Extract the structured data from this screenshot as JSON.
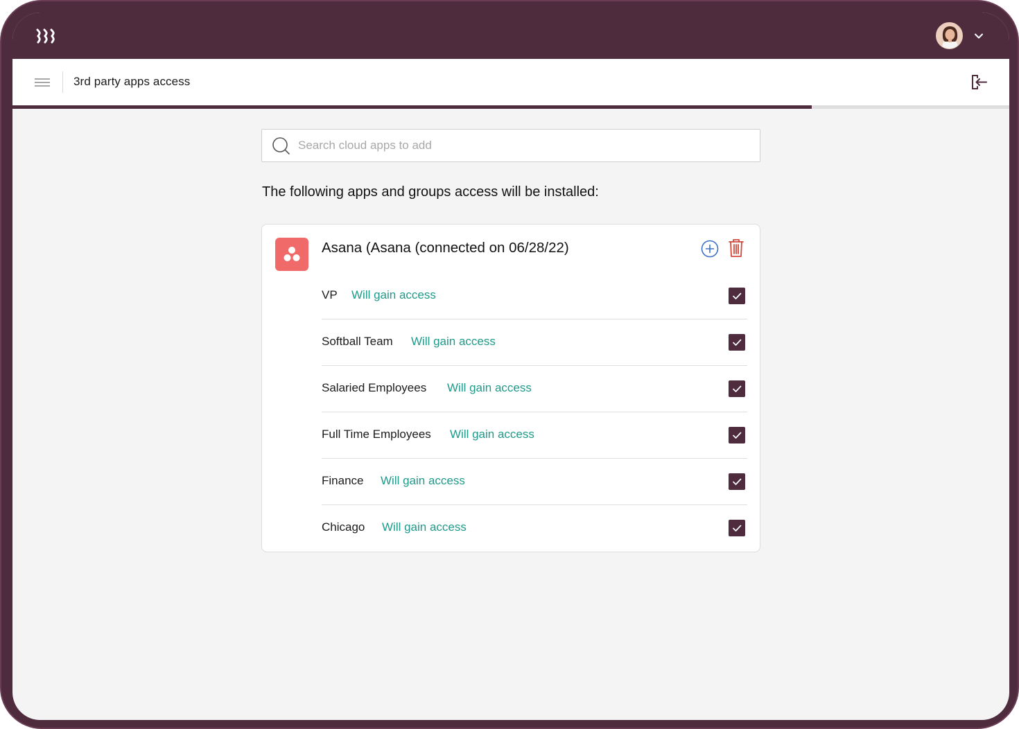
{
  "header": {
    "title": "3rd party apps access"
  },
  "progress": {
    "fraction": 0.802
  },
  "search": {
    "placeholder": "Search cloud apps to add"
  },
  "main": {
    "heading": "The following apps and groups access will be installed:"
  },
  "app": {
    "title": "Asana (Asana (connected on 06/28/22)",
    "icon_color": "#f06a6a",
    "groups": [
      {
        "name": "VP",
        "status": "Will gain access",
        "checked": true
      },
      {
        "name": "Softball Team",
        "status": "Will gain access",
        "checked": true
      },
      {
        "name": "Salaried Employees",
        "status": "Will gain access",
        "checked": true
      },
      {
        "name": "Full Time Employees",
        "status": "Will gain access",
        "checked": true
      },
      {
        "name": "Finance",
        "status": "Will gain access",
        "checked": true
      },
      {
        "name": "Chicago",
        "status": "Will gain access",
        "checked": true
      }
    ]
  },
  "colors": {
    "brand": "#4e2b3d",
    "status": "#1e9a8a",
    "add": "#3b6fc7",
    "delete": "#d0473a"
  },
  "icons": [
    "rippling-logo-icon",
    "avatar",
    "chevron-down-icon",
    "menu-icon",
    "exit-icon",
    "search-icon",
    "asana-icon",
    "add-circle-icon",
    "trash-icon",
    "checkbox-icon"
  ]
}
